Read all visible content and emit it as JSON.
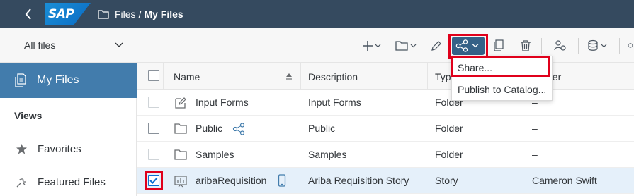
{
  "shell": {
    "logo_text": "SAP",
    "breadcrumb": {
      "folder": "Files",
      "separator": "/",
      "current": "My Files"
    }
  },
  "toolbar": {
    "filter_value": "All files",
    "icons": [
      "add-icon",
      "folder-icon",
      "edit-icon",
      "share-icon",
      "copy-icon",
      "delete-icon",
      "sharing-settings-icon",
      "data-icon"
    ]
  },
  "share_menu": {
    "items": [
      "Share...",
      "Publish to Catalog..."
    ]
  },
  "sidebar": {
    "active": "My Files",
    "views_header": "Views",
    "items": [
      {
        "label": "Favorites",
        "icon": "star-icon"
      },
      {
        "label": "Featured Files",
        "icon": "featured-icon"
      }
    ]
  },
  "table": {
    "columns": [
      "Name",
      "Description",
      "Type",
      "Owner"
    ],
    "rows": [
      {
        "name": "Input Forms",
        "description": "Input Forms",
        "type": "Folder",
        "owner": "–"
      },
      {
        "name": "Public",
        "description": "Public",
        "type": "Folder",
        "owner": "–"
      },
      {
        "name": "Samples",
        "description": "Samples",
        "type": "Folder",
        "owner": "–"
      },
      {
        "name": "aribaRequisition",
        "description": "Ariba Requisition Story",
        "type": "Story",
        "owner": "Cameron Swift",
        "checked": true
      }
    ]
  },
  "colors": {
    "shell": "#354a5f",
    "active": "#427cac",
    "highlight": "#e0001b",
    "share_button": "#346187"
  }
}
